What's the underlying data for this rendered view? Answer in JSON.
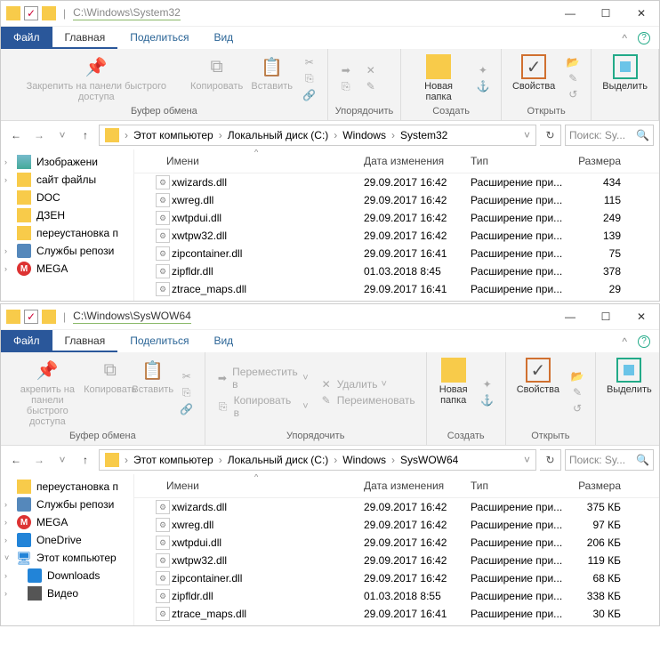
{
  "windows": [
    {
      "title_path": "C:\\Windows\\System32",
      "tabs": {
        "file": "Файл",
        "home": "Главная",
        "share": "Поделиться",
        "view": "Вид"
      },
      "ribbon": {
        "clipboard": {
          "pin": "Закрепить на панели\nбыстрого доступа",
          "copy": "Копировать",
          "paste": "Вставить",
          "label": "Буфер обмена"
        },
        "organize": {
          "label": "Упорядочить"
        },
        "new": {
          "folder": "Новая\nпапка",
          "label": "Создать"
        },
        "open": {
          "props": "Свойства",
          "label": "Открыть"
        },
        "select": {
          "btn": "Выделить",
          "label": ""
        }
      },
      "breadcrumbs": [
        "Этот компьютер",
        "Локальный диск (C:)",
        "Windows",
        "System32"
      ],
      "search_placeholder": "Поиск: Sy...",
      "tree": [
        {
          "icon": "img",
          "label": "Изображени",
          "arrow": ">"
        },
        {
          "icon": "folder",
          "label": "сайт файлы",
          "arrow": ">"
        },
        {
          "icon": "folder",
          "label": "DOC"
        },
        {
          "icon": "folder",
          "label": "ДЗЕН"
        },
        {
          "icon": "folder",
          "label": "переустановка п"
        },
        {
          "icon": "green",
          "label": "Службы репози",
          "arrow": ">"
        },
        {
          "icon": "red",
          "label": "MEGA",
          "arrow": ">",
          "glyph": "M"
        }
      ],
      "columns": {
        "name": "Имени",
        "date": "Дата изменения",
        "type": "Тип",
        "size": "Размера"
      },
      "files": [
        {
          "name": "xwizards.dll",
          "date": "29.09.2017 16:42",
          "type": "Расширение при...",
          "size": "434"
        },
        {
          "name": "xwreg.dll",
          "date": "29.09.2017 16:42",
          "type": "Расширение при...",
          "size": "115"
        },
        {
          "name": "xwtpdui.dll",
          "date": "29.09.2017 16:42",
          "type": "Расширение при...",
          "size": "249"
        },
        {
          "name": "xwtpw32.dll",
          "date": "29.09.2017 16:42",
          "type": "Расширение при...",
          "size": "139"
        },
        {
          "name": "zipcontainer.dll",
          "date": "29.09.2017 16:41",
          "type": "Расширение при...",
          "size": "75"
        },
        {
          "name": "zipfldr.dll",
          "date": "01.03.2018 8:45",
          "type": "Расширение при...",
          "size": "378"
        },
        {
          "name": "ztrace_maps.dll",
          "date": "29.09.2017 16:41",
          "type": "Расширение при...",
          "size": "29"
        }
      ]
    },
    {
      "title_path": "C:\\Windows\\SysWOW64",
      "tabs": {
        "file": "Файл",
        "home": "Главная",
        "share": "Поделиться",
        "view": "Вид"
      },
      "ribbon": {
        "clipboard": {
          "pin": "акрепить на панели\nбыстрого доступа",
          "copy": "Копировать",
          "paste": "Вставить",
          "label": "Буфер обмена"
        },
        "organize": {
          "move": "Переместить в",
          "copy": "Копировать в",
          "delete": "Удалить",
          "rename": "Переименовать",
          "label": "Упорядочить"
        },
        "new": {
          "folder": "Новая\nпапка",
          "label": "Создать"
        },
        "open": {
          "props": "Свойства",
          "label": "Открыть"
        },
        "select": {
          "btn": "Выделить",
          "label": ""
        }
      },
      "breadcrumbs": [
        "Этот компьютер",
        "Локальный диск (C:)",
        "Windows",
        "SysWOW64"
      ],
      "search_placeholder": "Поиск: Sy...",
      "tree": [
        {
          "icon": "folder",
          "label": "переустановка п"
        },
        {
          "icon": "green",
          "label": "Службы репози",
          "arrow": ">"
        },
        {
          "icon": "red",
          "label": "MEGA",
          "arrow": ">",
          "glyph": "M"
        },
        {
          "icon": "blue",
          "label": "OneDrive",
          "arrow": ">"
        },
        {
          "icon": "pc",
          "label": "Этот компьютер",
          "arrow": "v",
          "glyph": "🖥"
        },
        {
          "icon": "blue",
          "label": "Downloads",
          "arrow": ">",
          "indent": true
        },
        {
          "icon": "video",
          "label": "Видео",
          "arrow": ">",
          "indent": true
        }
      ],
      "columns": {
        "name": "Имени",
        "date": "Дата изменения",
        "type": "Тип",
        "size": "Размера"
      },
      "files": [
        {
          "name": "xwizards.dll",
          "date": "29.09.2017 16:42",
          "type": "Расширение при...",
          "size": "375 КБ"
        },
        {
          "name": "xwreg.dll",
          "date": "29.09.2017 16:42",
          "type": "Расширение при...",
          "size": "97 КБ"
        },
        {
          "name": "xwtpdui.dll",
          "date": "29.09.2017 16:42",
          "type": "Расширение при...",
          "size": "206 КБ"
        },
        {
          "name": "xwtpw32.dll",
          "date": "29.09.2017 16:42",
          "type": "Расширение при...",
          "size": "119 КБ"
        },
        {
          "name": "zipcontainer.dll",
          "date": "29.09.2017 16:42",
          "type": "Расширение при...",
          "size": "68 КБ"
        },
        {
          "name": "zipfldr.dll",
          "date": "01.03.2018 8:55",
          "type": "Расширение при...",
          "size": "338 КБ"
        },
        {
          "name": "ztrace_maps.dll",
          "date": "29.09.2017 16:41",
          "type": "Расширение при...",
          "size": "30 КБ"
        }
      ]
    }
  ]
}
